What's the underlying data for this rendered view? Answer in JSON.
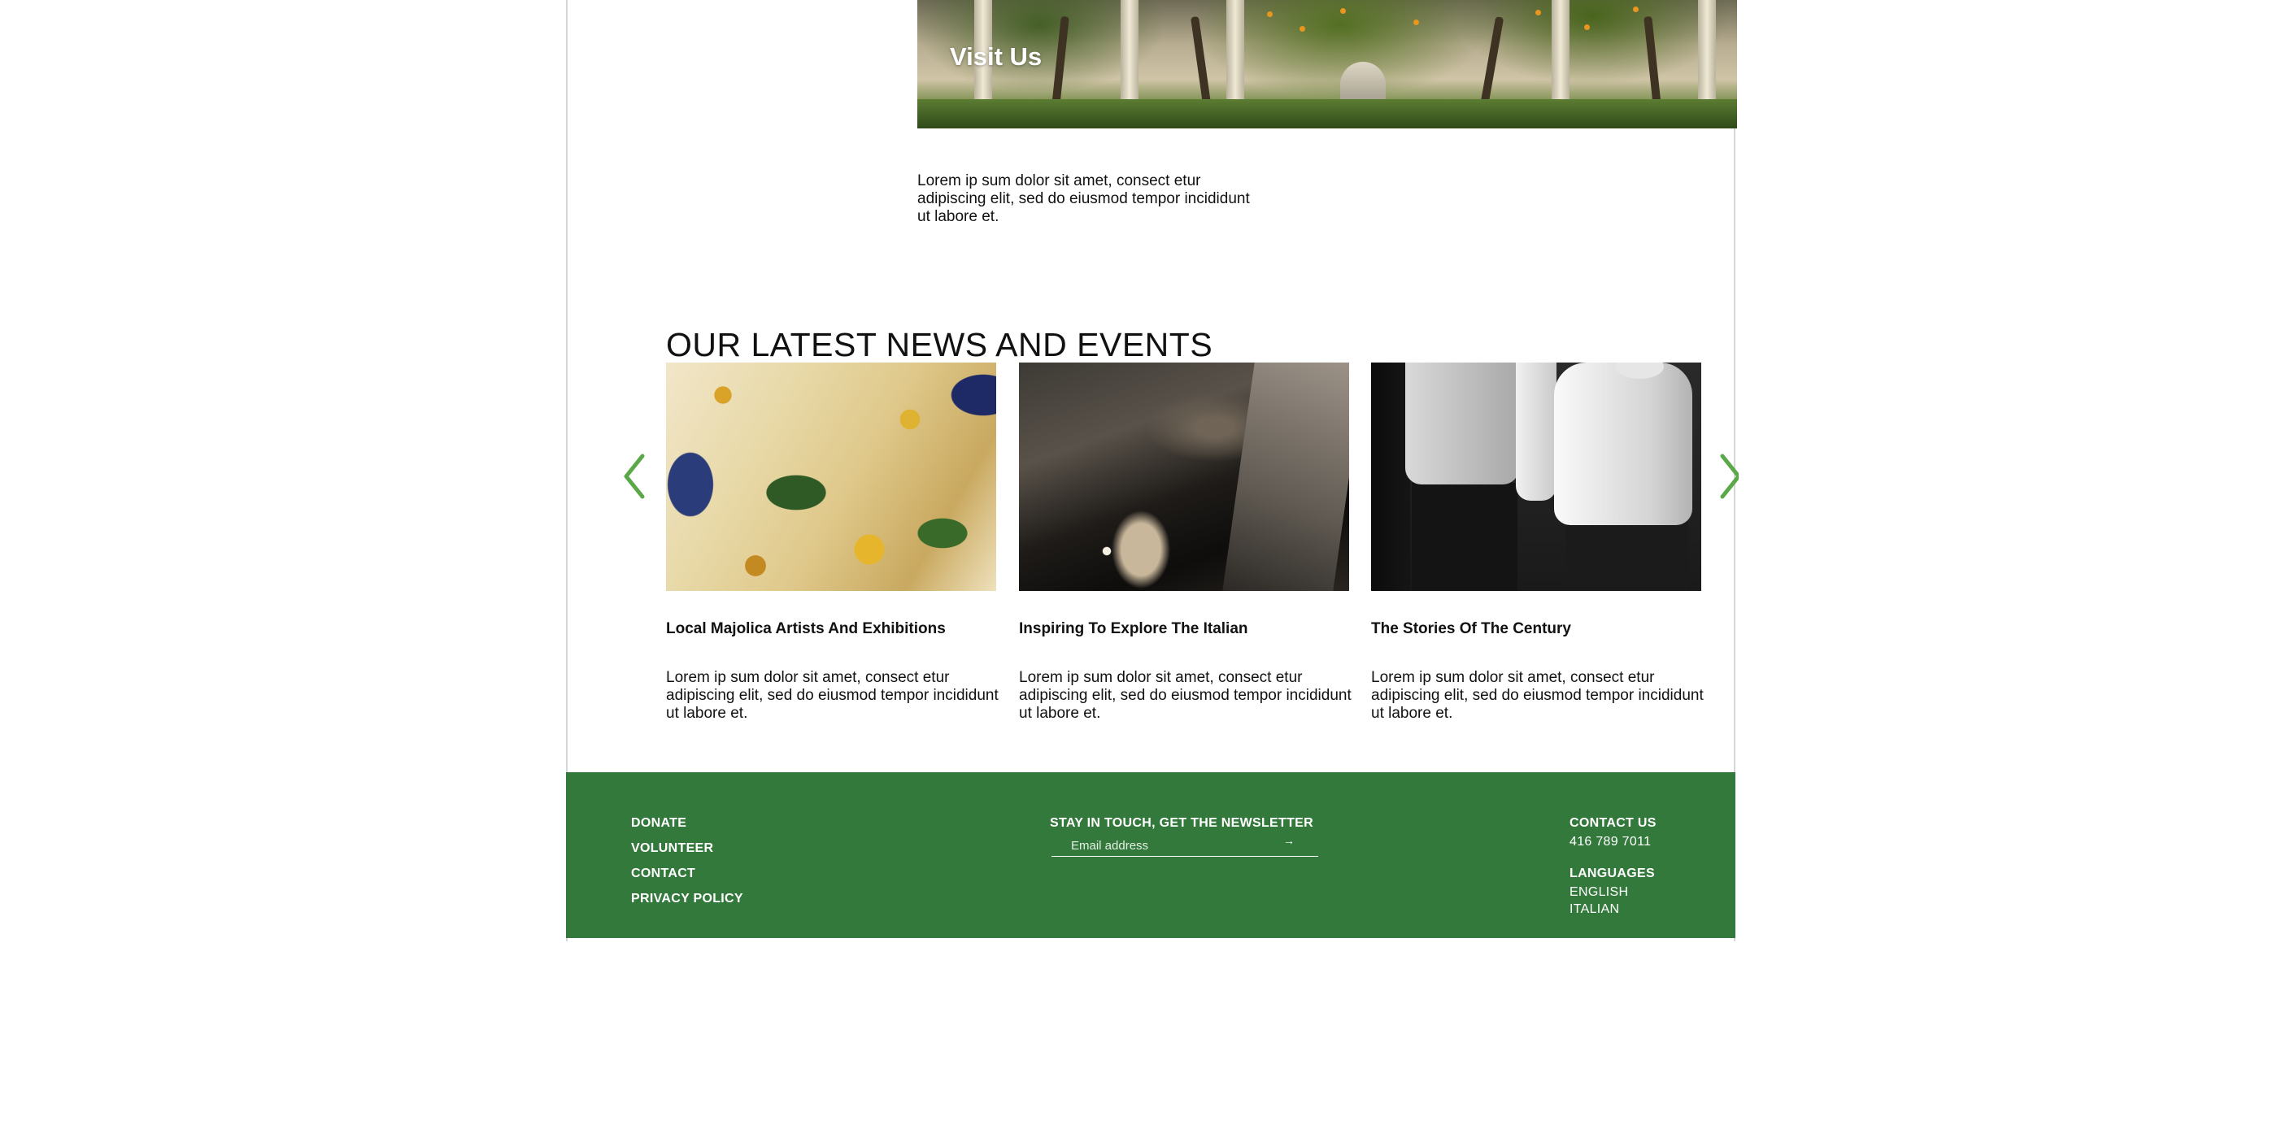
{
  "visit": {
    "title": "Visit Us",
    "body": "Lorem ip sum dolor sit amet, consect etur adipiscing elit, sed do eiusmod tempor incididunt ut labore et."
  },
  "news": {
    "title": "OUR LATEST NEWS AND EVENTS",
    "cards": [
      {
        "heading": "Local Majolica Artists And Exhibitions",
        "text": "Lorem ip sum dolor sit amet, consect etur adipiscing elit, sed do eiusmod tempor incididunt ut labore et."
      },
      {
        "heading": "Inspiring To Explore The Italian",
        "text": "Lorem ip sum dolor sit amet, consect etur adipiscing elit, sed do eiusmod tempor incididunt ut labore et."
      },
      {
        "heading": "The Stories Of The Century",
        "text": "Lorem ip sum dolor sit amet, consect etur adipiscing elit, sed do eiusmod tempor incididunt ut labore et."
      }
    ]
  },
  "footer": {
    "links": [
      "DONATE",
      "VOLUNTEER",
      "CONTACT",
      "PRIVACY POLICY"
    ],
    "newsletter_title": "STAY IN TOUCH, GET THE NEWSLETTER",
    "email_placeholder": "Email address",
    "submit_glyph": "→",
    "contact_heading": "CONTACT US",
    "phone": "416 789 7011",
    "languages_heading": "LANGUAGES",
    "languages": [
      "ENGLISH",
      "ITALIAN"
    ]
  },
  "colors": {
    "brand_green": "#34793c",
    "arrow_green": "#5aa848"
  },
  "icons": {
    "prev": "chevron-left-icon",
    "next": "chevron-right-icon",
    "submit": "arrow-right-icon"
  }
}
